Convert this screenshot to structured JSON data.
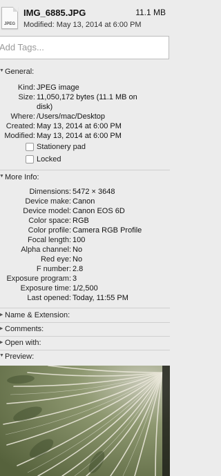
{
  "header": {
    "file_icon_label": "JPEG",
    "file_name": "IMG_6885.JPG",
    "file_size": "11.1 MB",
    "modified": "Modified: May 13, 2014 at 6:00 PM"
  },
  "tags": {
    "placeholder": "Add Tags..."
  },
  "general": {
    "title": "General:",
    "kind_label": "Kind:",
    "kind_value": "JPEG image",
    "size_label": "Size:",
    "size_value_line1": "11,050,172 bytes (11.1 MB on",
    "size_value_line2": "disk)",
    "where_label": "Where:",
    "where_value": "/Users/mac/Desktop",
    "created_label": "Created:",
    "created_value": "May 13, 2014 at 6:00 PM",
    "modified_label": "Modified:",
    "modified_value": "May 13, 2014 at 6:00 PM",
    "stationery_label": "Stationery pad",
    "locked_label": "Locked"
  },
  "more_info": {
    "title": "More Info:",
    "rows": [
      {
        "label": "Dimensions:",
        "value": "5472 × 3648"
      },
      {
        "label": "Device make:",
        "value": "Canon"
      },
      {
        "label": "Device model:",
        "value": "Canon EOS 6D"
      },
      {
        "label": "Color space:",
        "value": "RGB"
      },
      {
        "label": "Color profile:",
        "value": "Camera RGB Profile"
      },
      {
        "label": "Focal length:",
        "value": "100"
      },
      {
        "label": "Alpha channel:",
        "value": "No"
      },
      {
        "label": "Red eye:",
        "value": "No"
      },
      {
        "label": "F number:",
        "value": "2.8"
      },
      {
        "label": "Exposure program:",
        "value": "3"
      },
      {
        "label": "Exposure time:",
        "value": "1/2,500"
      },
      {
        "label": "Last opened:",
        "value": "Today, 11:55 PM"
      }
    ]
  },
  "sections": {
    "name_extension": "Name & Extension:",
    "comments": "Comments:",
    "open_with": "Open with:",
    "preview": "Preview:"
  }
}
